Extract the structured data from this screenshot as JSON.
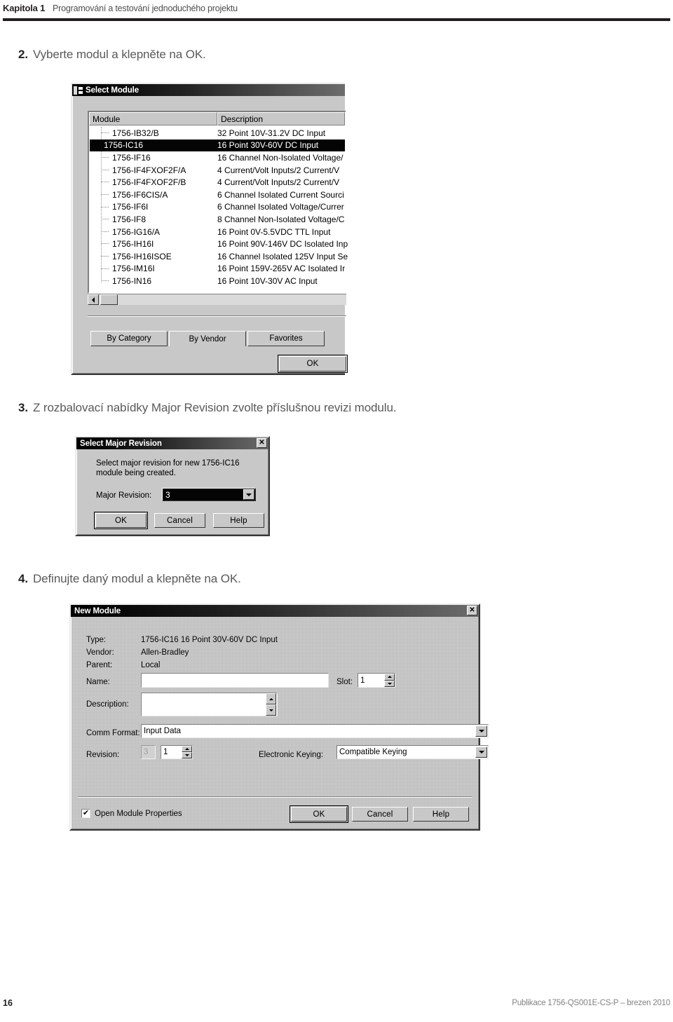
{
  "header": {
    "chapter": "Kapitola 1",
    "title": "Programování a testování jednoduchého projektu"
  },
  "steps": [
    {
      "num": "2.",
      "text": "Vyberte modul a klepněte na OK."
    },
    {
      "num": "3.",
      "text": "Z rozbalovací nabídky Major Revision zvolte příslušnou revizi modulu."
    },
    {
      "num": "4.",
      "text": "Definujte daný modul a klepněte na OK."
    }
  ],
  "select_module_dialog": {
    "title": "Select Module",
    "columns": {
      "module": "Module",
      "description": "Description"
    },
    "rows": [
      {
        "module": "1756-IB32/B",
        "description": "32 Point 10V-31.2V DC Input",
        "selected": false
      },
      {
        "module": "1756-IC16",
        "description": "16 Point 30V-60V DC Input",
        "selected": true
      },
      {
        "module": "1756-IF16",
        "description": "16 Channel Non-Isolated Voltage/",
        "selected": false
      },
      {
        "module": "1756-IF4FXOF2F/A",
        "description": "4 Current/Volt Inputs/2 Current/V",
        "selected": false
      },
      {
        "module": "1756-IF4FXOF2F/B",
        "description": "4 Current/Volt Inputs/2 Current/V",
        "selected": false
      },
      {
        "module": "1756-IF6CIS/A",
        "description": "6 Channel Isolated Current Sourci",
        "selected": false
      },
      {
        "module": "1756-IF6I",
        "description": "6 Channel Isolated Voltage/Currer",
        "selected": false
      },
      {
        "module": "1756-IF8",
        "description": "8 Channel Non-Isolated Voltage/C",
        "selected": false
      },
      {
        "module": "1756-IG16/A",
        "description": "16 Point 0V-5.5VDC TTL Input",
        "selected": false
      },
      {
        "module": "1756-IH16I",
        "description": "16 Point 90V-146V DC Isolated Inp",
        "selected": false
      },
      {
        "module": "1756-IH16ISOE",
        "description": "16 Channel Isolated 125V Input Se",
        "selected": false
      },
      {
        "module": "1756-IM16I",
        "description": "16 Point 159V-265V AC Isolated Ir",
        "selected": false
      },
      {
        "module": "1756-IN16",
        "description": "16 Point 10V-30V AC Input",
        "selected": false
      }
    ],
    "tabs": [
      {
        "label": "By Category",
        "active": true
      },
      {
        "label": "By Vendor",
        "active": false
      },
      {
        "label": "Favorites",
        "active": false
      }
    ],
    "ok_label": "OK"
  },
  "major_revision_dialog": {
    "title": "Select Major Revision",
    "close_glyph": "✕",
    "message": "Select major revision for new 1756-IC16 module being created.",
    "field_label": "Major Revision:",
    "field_value": "3",
    "buttons": {
      "ok": "OK",
      "cancel": "Cancel",
      "help": "Help"
    }
  },
  "new_module_dialog": {
    "title": "New Module",
    "close_glyph": "✕",
    "fields": {
      "type_label": "Type:",
      "type_value": "1756-IC16 16 Point 30V-60V DC Input",
      "vendor_label": "Vendor:",
      "vendor_value": "Allen-Bradley",
      "parent_label": "Parent:",
      "parent_value": "Local",
      "name_label": "Name:",
      "name_value": "",
      "slot_label": "Slot:",
      "slot_value": "1",
      "description_label": "Description:",
      "description_value": "",
      "comm_format_label": "Comm Format:",
      "comm_format_value": "Input Data",
      "revision_label": "Revision:",
      "revision_major": "3",
      "revision_minor": "1",
      "electronic_keying_label": "Electronic Keying:",
      "electronic_keying_value": "Compatible Keying"
    },
    "open_module_properties": {
      "label": "Open Module Properties",
      "checked": true,
      "check_glyph": "✔"
    },
    "buttons": {
      "ok": "OK",
      "cancel": "Cancel",
      "help": "Help"
    }
  },
  "footer": {
    "page_number": "16",
    "publication": "Publikace 1756-QS001E-CS-P – brezen 2010"
  }
}
